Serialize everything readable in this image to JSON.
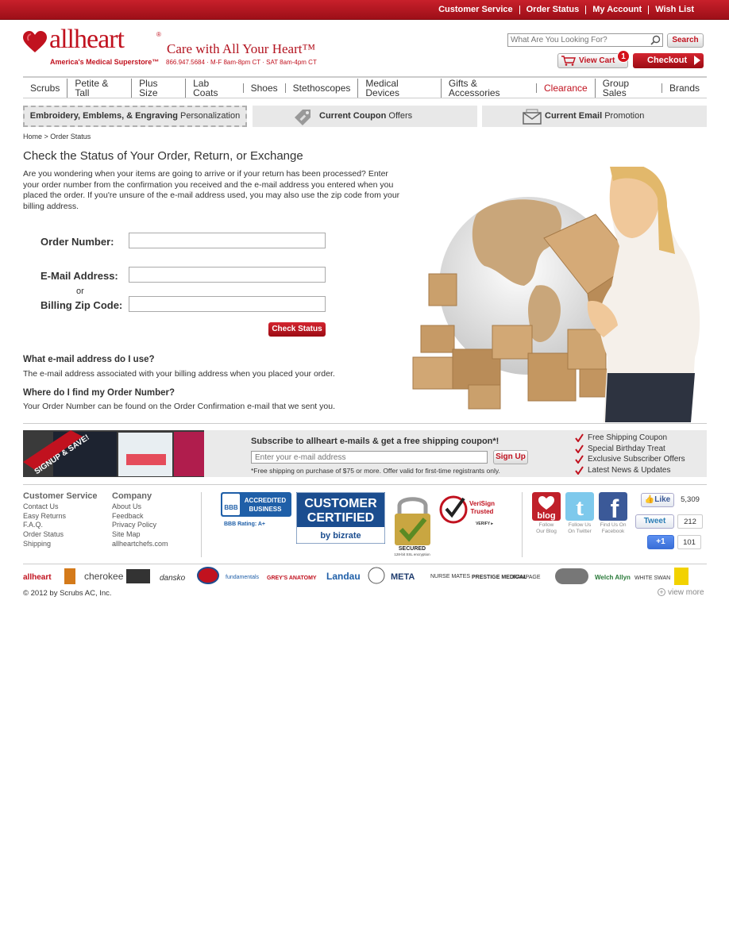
{
  "top_links": [
    "Customer Service",
    "Order Status",
    "My Account",
    "Wish List"
  ],
  "brand": {
    "name": "allheart",
    "registered": "®",
    "subtitle": "America's Medical Superstore™",
    "tagline": "Care with All Your Heart™",
    "phone": "866.947.5684 · M-F 8am-8pm CT · SAT 8am-4pm CT"
  },
  "search": {
    "placeholder": "What Are You Looking For?",
    "button": "Search"
  },
  "cart": {
    "label": "View Cart",
    "count": "1",
    "checkout": "Checkout"
  },
  "nav": [
    "Scrubs",
    "Petite & Tall",
    "Plus Size",
    "Lab Coats",
    "Shoes",
    "Stethoscopes",
    "Medical Devices",
    "Gifts & Accessories",
    "Clearance",
    "Group Sales",
    "Brands"
  ],
  "promos": {
    "p1_bold": "Embroidery, Emblems, & Engraving",
    "p1_rest": " Personalization",
    "p2_bold": "Current Coupon",
    "p2_rest": " Offers",
    "p3_bold": "Current Email",
    "p3_rest": " Promotion"
  },
  "breadcrumb": "Home > Order Status",
  "page_title": "Check the Status of Your Order, Return, or Exchange",
  "intro": "Are you wondering when your items are going to arrive or if your return has been processed? Enter your order number from the confirmation you received and the e-mail address you entered when you placed the order. If you're unsure of the e-mail address used, you may also use the zip code from your billing address.",
  "form": {
    "order_label": "Order Number:",
    "email_label": "E-Mail Address:",
    "or": "or",
    "zip_label": "Billing Zip Code:",
    "order_value": "",
    "email_value": "",
    "zip_value": "",
    "submit": "Check Status"
  },
  "faq": [
    {
      "q": "What e-mail address do I use?",
      "a": "The e-mail address associated with your billing address when you placed your order."
    },
    {
      "q": "Where do I find my Order Number?",
      "a": "Your Order Number can be found on the Order Confirmation e-mail that we sent you."
    }
  ],
  "signup": {
    "banner_text": "SIGNUP & SAVE!",
    "title": "Subscribe to allheart e-mails & get a free shipping coupon*!",
    "placeholder": "Enter your e-mail address",
    "button": "Sign Up",
    "note": "*Free shipping on purchase of $75 or more. Offer valid for first-time registrants only.",
    "benefits": [
      "Free Shipping Coupon",
      "Special Birthday Treat",
      "Exclusive Subscriber Offers",
      "Latest News & Updates"
    ]
  },
  "footer": {
    "customer_service": {
      "title": "Customer Service",
      "links": [
        "Contact Us",
        "Easy Returns",
        "F.A.Q.",
        "Order Status",
        "Shipping"
      ]
    },
    "company": {
      "title": "Company",
      "links": [
        "About Us",
        "Feedback",
        "Privacy Policy",
        "Site Map",
        "allheartchefs.com"
      ]
    },
    "bbb": {
      "line1": "ACCREDITED",
      "line2": "BUSINESS",
      "rating": "BBB Rating: A+",
      "mark": "BBB"
    },
    "bizrate": {
      "line1": "CUSTOMER",
      "line2": "CERTIFIED",
      "by": "by bizrate"
    },
    "ssl": {
      "label": "SECURED",
      "sub": "128-bit SSL encryption"
    },
    "verisign": {
      "line1": "VeriSign",
      "line2": "Trusted",
      "verify": "VERIFY ▸"
    },
    "social": [
      {
        "name": "blog",
        "caption1": "Follow",
        "caption2": "Our Blog"
      },
      {
        "name": "twitter",
        "caption1": "Follow Us",
        "caption2": "On Twitter"
      },
      {
        "name": "facebook",
        "caption1": "Find Us On",
        "caption2": "Facebook"
      }
    ],
    "like": {
      "label": "Like",
      "count": "5,309"
    },
    "tweet": {
      "label": "Tweet",
      "count": "212"
    },
    "plusone": {
      "label": "+1",
      "count": "101"
    }
  },
  "brands": [
    "allheart",
    "cherokee",
    "dansko",
    "fundamentals",
    "GREY'S ANATOMY",
    "Landau",
    "META",
    "NURSE MATES",
    "PRESTIGE MEDICAL",
    "RAMPAGE",
    "Welch Allyn",
    "WHITE SWAN"
  ],
  "copyright": "© 2012 by Scrubs AC, Inc.",
  "view_more": "view more",
  "colors": {
    "brand_red": "#c1121f",
    "nav_clearance": "#c1121f"
  }
}
